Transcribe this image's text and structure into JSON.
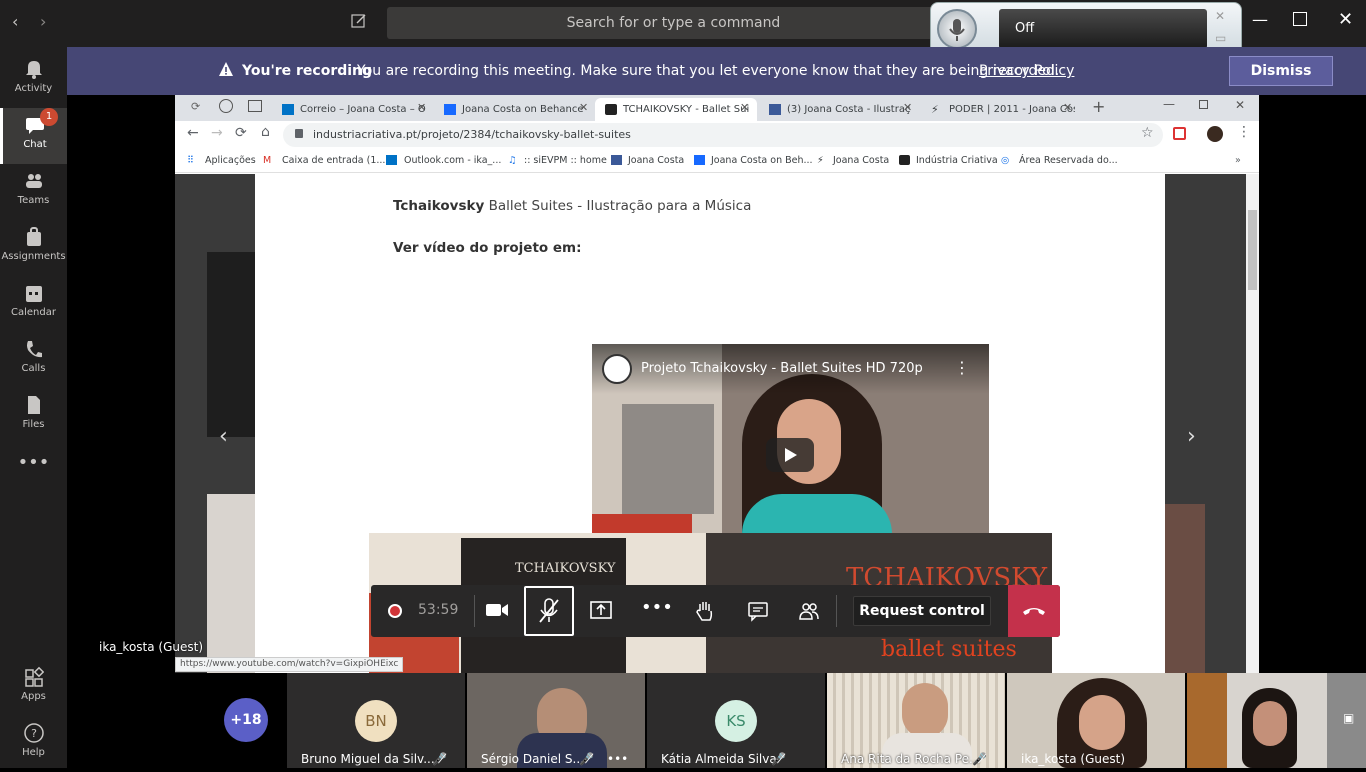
{
  "teams": {
    "search_placeholder": "Search for or type a command",
    "rail": [
      {
        "label": "Activity",
        "icon": "bell-icon"
      },
      {
        "label": "Chat",
        "icon": "chat-icon",
        "badge": "1"
      },
      {
        "label": "Teams",
        "icon": "teams-icon"
      },
      {
        "label": "Assignments",
        "icon": "assignments-icon"
      },
      {
        "label": "Calendar",
        "icon": "calendar-icon"
      },
      {
        "label": "Calls",
        "icon": "phone-icon"
      },
      {
        "label": "Files",
        "icon": "files-icon"
      },
      {
        "label": "Apps",
        "icon": "apps-icon"
      },
      {
        "label": "Help",
        "icon": "help-icon"
      }
    ],
    "mic_widget": {
      "status": "Off"
    },
    "recording": {
      "title": "You're recording",
      "message": "You are recording this meeting. Make sure that you let everyone know that they are being recorded.",
      "link": "Privacy Policy",
      "dismiss": "Dismiss"
    },
    "presenter_label": "ika_kosta (Guest)",
    "status_url": "https://www.youtube.com/watch?v=GixpiOHEixc",
    "controls": {
      "timer": "53:59",
      "request_control": "Request control"
    },
    "participants": {
      "overflow": "+18",
      "tiles": [
        {
          "initials": "BN",
          "name": "Bruno Miguel da Silv..."
        },
        {
          "initials": "",
          "name": "Sérgio Daniel S..."
        },
        {
          "initials": "KS",
          "name": "Kátia Almeida Silva"
        },
        {
          "initials": "",
          "name": "Ana Rita da Rocha Pe..."
        },
        {
          "initials": "",
          "name": "ika_kosta (Guest)"
        }
      ]
    }
  },
  "browser": {
    "tabs": [
      {
        "label": "Correio – Joana Costa – O"
      },
      {
        "label": "Joana Costa on Behance"
      },
      {
        "label": "TCHAIKOVSKY - Ballet Sui"
      },
      {
        "label": "(3) Joana Costa - Ilustraç"
      },
      {
        "label": "PODER | 2011 - Joana Cos"
      }
    ],
    "url": "industriacriativa.pt/projeto/2384/tchaikovsky-ballet-suites",
    "bookmarks": [
      "Aplicações",
      "Caixa de entrada (1...",
      "Outlook.com - ika_...",
      ":: siEVPM :: home",
      "Joana Costa",
      "Joana Costa on Beh...",
      "Joana Costa",
      "Indústria Criativa",
      "Área Reservada do..."
    ]
  },
  "page": {
    "heading_bold": "Tchaikovsky",
    "heading_rest": "Ballet Suites - Ilustração para a Música",
    "video_label": "Ver vídeo do projeto em:",
    "video_title": "Projeto Tchaikovsky - Ballet Suites HD 720p",
    "image1_text": "TCHAIKOVSKY",
    "image2_text1": "TCHAIKOVSKY",
    "image2_text2": "ballet suites"
  }
}
